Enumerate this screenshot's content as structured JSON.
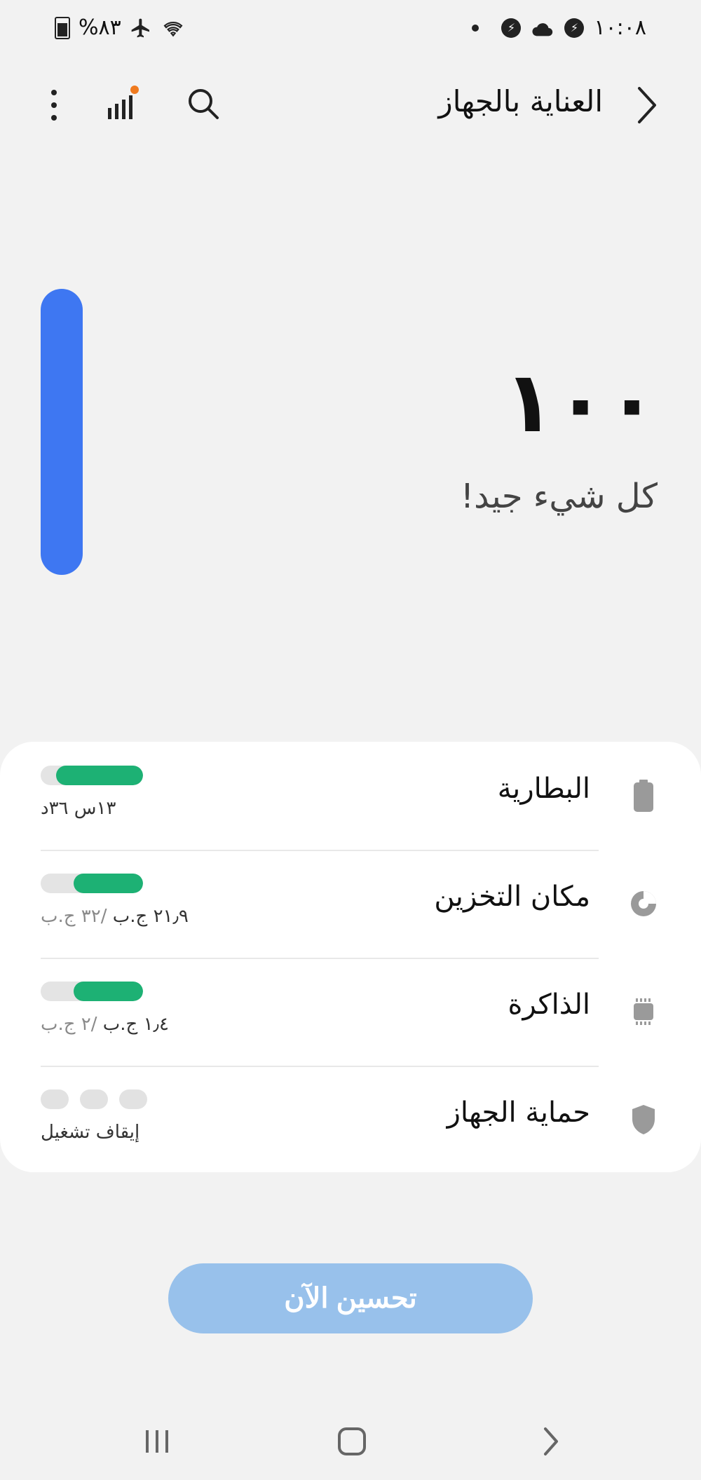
{
  "status_bar": {
    "battery": "%٨٣",
    "time": "١٠:٠٨"
  },
  "header": {
    "title": "العناية بالجهاز"
  },
  "score": {
    "value": "١٠٠",
    "message": "كل شيء جيد!",
    "level": 1.0
  },
  "items": [
    {
      "label": "البطارية",
      "icon": "battery-icon",
      "value": "١٣س ٣٦د",
      "total": "",
      "fill": 0.85
    },
    {
      "label": "مكان التخزين",
      "icon": "storage-pie-icon",
      "value": "٢١٫٩ ج.ب",
      "total": "/٣٢ ج.ب",
      "fill": 0.68
    },
    {
      "label": "الذاكرة",
      "icon": "memory-chip-icon",
      "value": "١٫٤ ج.ب",
      "total": "/٢ ج.ب",
      "fill": 0.68
    },
    {
      "label": "حماية الجهاز",
      "icon": "shield-icon",
      "value": "إيقاف تشغيل",
      "total": ""
    }
  ],
  "optimize_button": {
    "label": "تحسين الآن"
  },
  "colors": {
    "accent": "#3e77f2",
    "meter": "#1db174",
    "button": "#98c1eb",
    "background": "#f2f2f2"
  }
}
